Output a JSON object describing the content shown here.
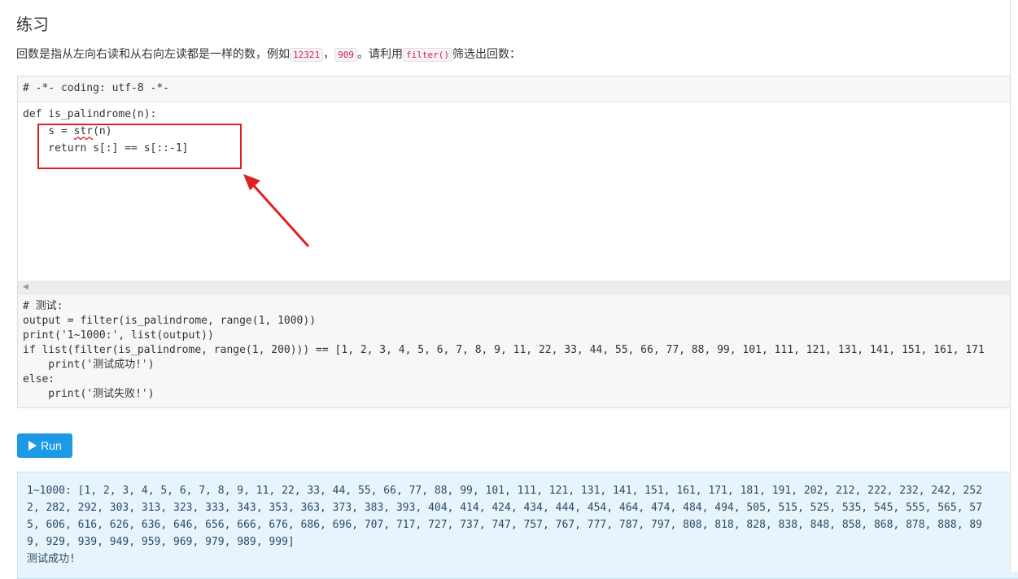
{
  "section_title": "练习",
  "description": {
    "prefix": "回数是指从左向右读和从右向左读都是一样的数，例如",
    "example1": "12321",
    "separator": "，",
    "example2": "909",
    "middle": "。请利用",
    "func": "filter()",
    "suffix": "筛选出回数："
  },
  "editor": {
    "header_line": "# -*- coding: utf-8 -*-",
    "code": {
      "def_line": "def is_palindrome(n):",
      "line_s_prefix": "    s = ",
      "line_s_str": "str",
      "line_s_suffix": "(n)",
      "return_line": "    return s[:] == s[::-1]"
    },
    "test_lines": [
      "# 测试:",
      "output = filter(is_palindrome, range(1, 1000))",
      "print('1~1000:', list(output))",
      "if list(filter(is_palindrome, range(1, 200))) == [1, 2, 3, 4, 5, 6, 7, 8, 9, 11, 22, 33, 44, 55, 66, 77, 88, 99, 101, 111, 121, 131, 141, 151, 161, 171",
      "    print('测试成功!')",
      "else:",
      "    print('测试失败!')"
    ]
  },
  "run_button": {
    "label": "Run",
    "icon": "play-icon"
  },
  "output": {
    "lines": [
      "1~1000: [1, 2, 3, 4, 5, 6, 7, 8, 9, 11, 22, 33, 44, 55, 66, 77, 88, 99, 101, 111, 121, 131, 141, 151, 161, 171, 181, 191, 202, 212, 222, 232, 242, 252",
      "2, 282, 292, 303, 313, 323, 333, 343, 353, 363, 373, 383, 393, 404, 414, 424, 434, 444, 454, 464, 474, 484, 494, 505, 515, 525, 535, 545, 555, 565, 57",
      "5, 606, 616, 626, 636, 646, 656, 666, 676, 686, 696, 707, 717, 727, 737, 747, 757, 767, 777, 787, 797, 808, 818, 828, 838, 848, 858, 868, 878, 888, 89",
      "9, 929, 939, 949, 959, 969, 979, 989, 999]",
      "测试成功!"
    ]
  },
  "colors": {
    "annotation": "#e02020",
    "run_button": "#1d9ae5",
    "output_bg": "#e8f4fb"
  }
}
